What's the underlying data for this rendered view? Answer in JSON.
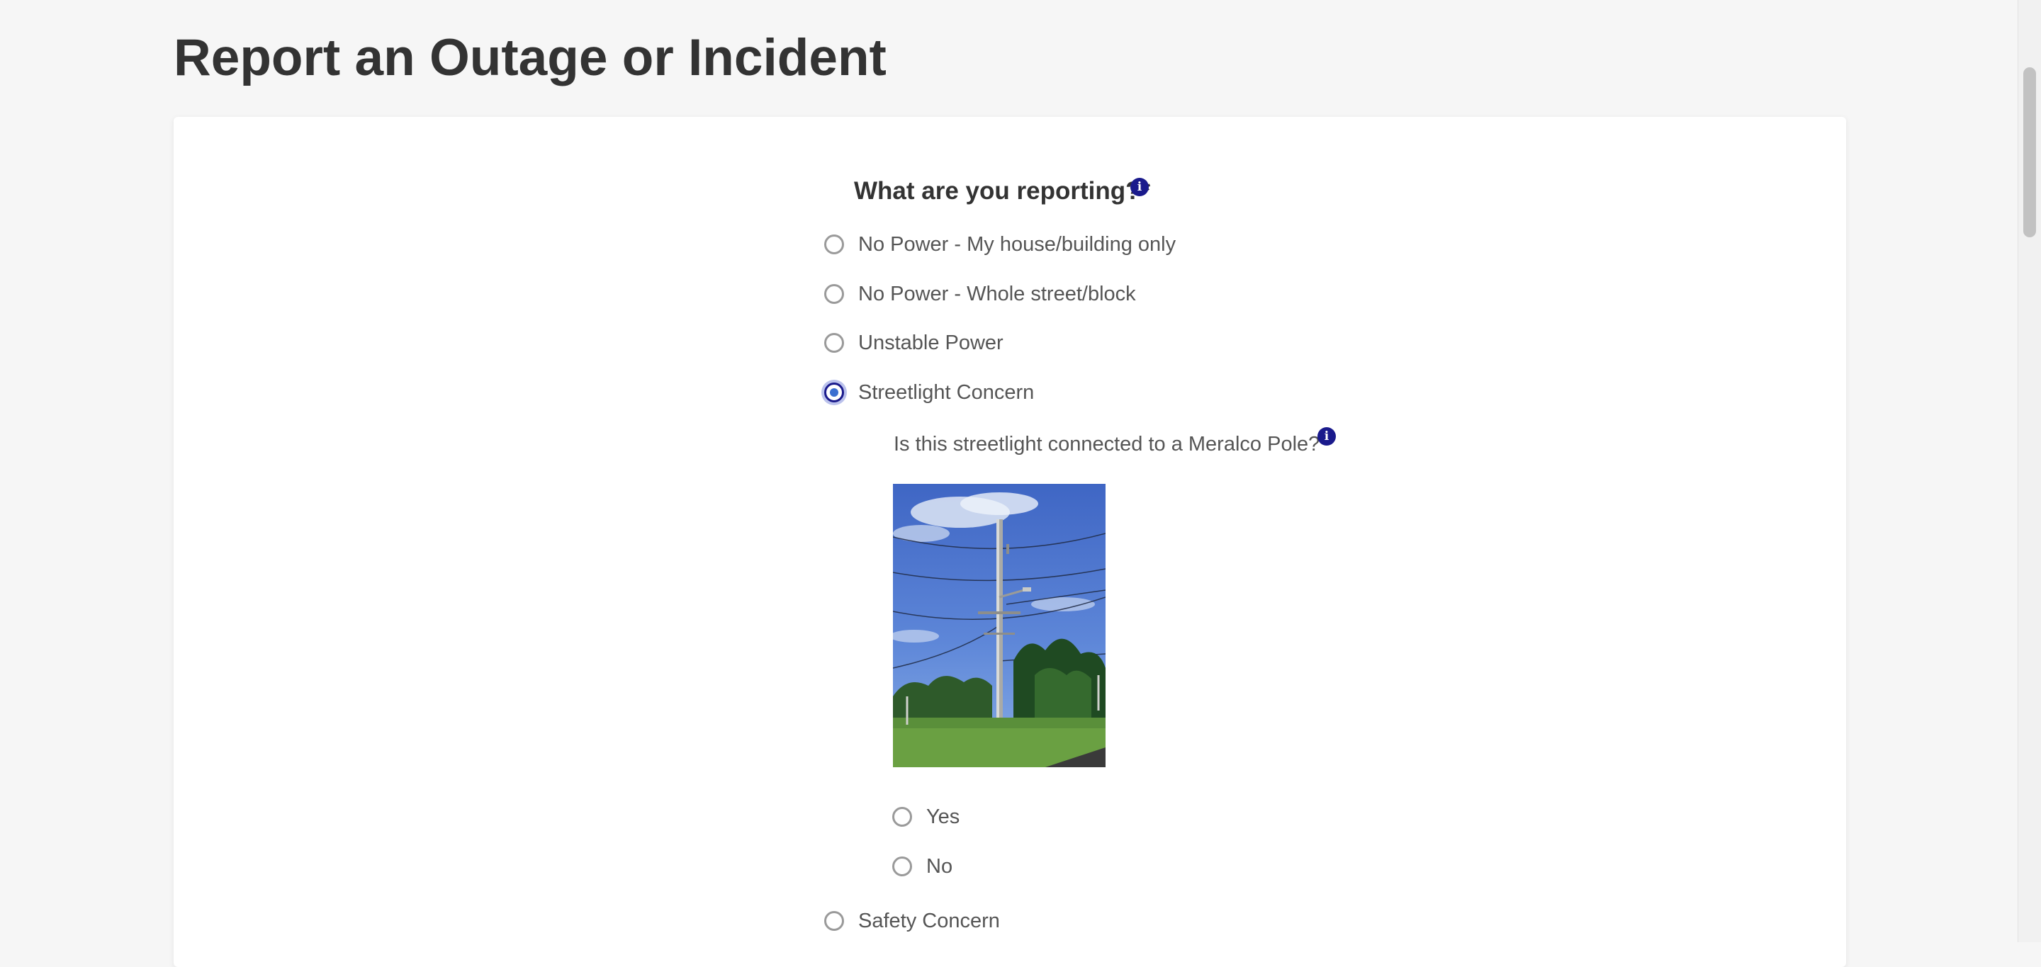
{
  "page": {
    "title": "Report an Outage or Incident"
  },
  "form": {
    "question": "What are you reporting?",
    "required_mark": "*",
    "info_glyph": "i",
    "options": [
      {
        "label": "No Power - My house/building only",
        "selected": false
      },
      {
        "label": "No Power - Whole street/block",
        "selected": false
      },
      {
        "label": "Unstable Power",
        "selected": false
      },
      {
        "label": "Streetlight Concern",
        "selected": true
      },
      {
        "label": "Safety Concern",
        "selected": false
      }
    ],
    "sub_question": {
      "text": "Is this streetlight connected to a Meralco Pole?",
      "required_mark": "*",
      "options": [
        {
          "label": "Yes",
          "selected": false
        },
        {
          "label": "No",
          "selected": false
        }
      ]
    }
  },
  "icons": {
    "info": "info-icon",
    "radio": "radio-button"
  },
  "colors": {
    "accent": "#1a1a8c",
    "radio_selected_fill": "#3b6fd0",
    "background": "#f6f6f6",
    "card": "#ffffff"
  }
}
